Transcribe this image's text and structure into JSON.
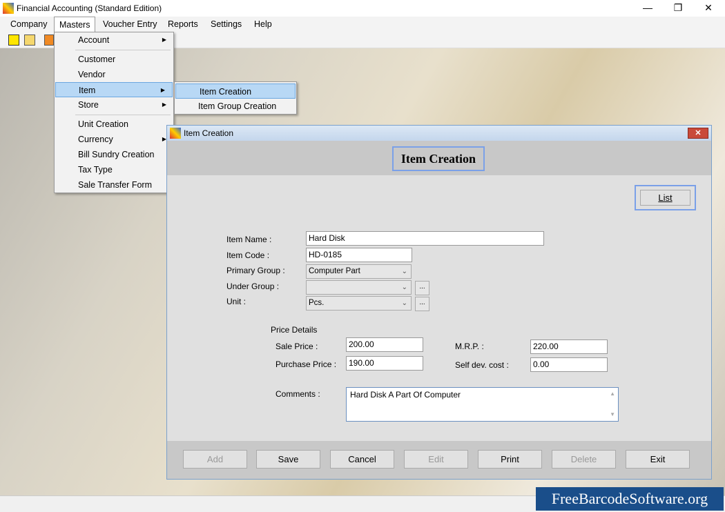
{
  "app": {
    "title": "Financial Accounting (Standard Edition)",
    "minimize": "—",
    "maximize": "❐",
    "close": "✕"
  },
  "menubar": [
    "Company",
    "Masters",
    "Voucher Entry",
    "Reports",
    "Settings",
    "Help"
  ],
  "masters_menu": [
    "Account",
    "Customer",
    "Vendor",
    "Item",
    "Store",
    "Unit Creation",
    "Currency",
    "Bill Sundry Creation",
    "Tax Type",
    "Sale Transfer Form"
  ],
  "item_submenu": [
    "Item Creation",
    "Item Group Creation"
  ],
  "dialog": {
    "title": "Item Creation",
    "header": "Item Creation",
    "list_button": "List",
    "labels": {
      "item_name": "Item Name :",
      "item_code": "Item Code :",
      "primary_group": "Primary Group :",
      "under_group": "Under Group :",
      "unit": "Unit :",
      "price_details": "Price Details",
      "sale_price": "Sale Price :",
      "purchase_price": "Purchase Price :",
      "mrp": "M.R.P. :",
      "self_dev_cost": "Self dev. cost :",
      "comments": "Comments :"
    },
    "values": {
      "item_name": "Hard Disk",
      "item_code": "HD-0185",
      "primary_group": "Computer Part",
      "under_group": "",
      "unit": "Pcs.",
      "sale_price": "200.00",
      "purchase_price": "190.00",
      "mrp": "220.00",
      "self_dev_cost": "0.00",
      "comments": "Hard Disk A Part Of Computer"
    },
    "dots": "...",
    "buttons": [
      {
        "label": "Add",
        "enabled": false
      },
      {
        "label": "Save",
        "enabled": true
      },
      {
        "label": "Cancel",
        "enabled": true
      },
      {
        "label": "Edit",
        "enabled": false
      },
      {
        "label": "Print",
        "enabled": true
      },
      {
        "label": "Delete",
        "enabled": false
      },
      {
        "label": "Exit",
        "enabled": true
      }
    ]
  },
  "watermark": "FreeBarcodeSoftware.org",
  "colors": {
    "highlight": "#b8d8f5",
    "watermark_bg": "#1a4e8a"
  }
}
